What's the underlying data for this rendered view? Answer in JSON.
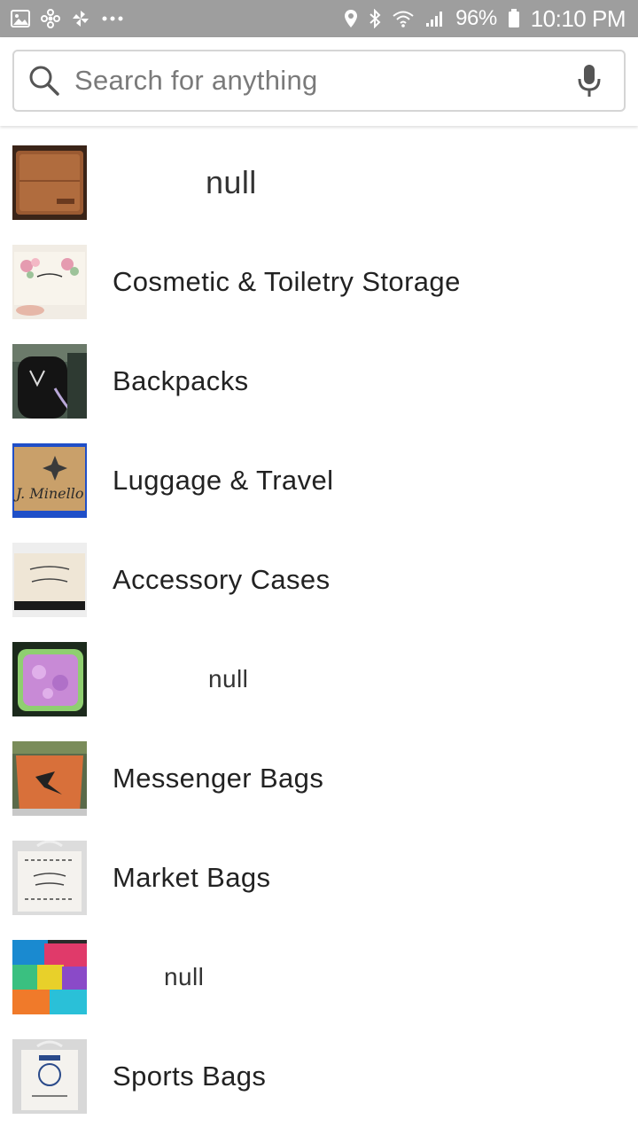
{
  "status_bar": {
    "battery": "96%",
    "time": "10:10 PM",
    "bg_color": "#9e9e9e",
    "left_icons": [
      "gallery-icon",
      "pinwheel-icon",
      "pinwheel-alt-icon",
      "more-dots-icon"
    ],
    "right_icons": [
      "location-icon",
      "bluetooth-icon",
      "wifi-icon",
      "signal-icon",
      "battery-icon"
    ]
  },
  "search": {
    "placeholder": "Search for anything",
    "value": "",
    "icon": "search-icon",
    "voice_icon": "mic-icon"
  },
  "categories": [
    {
      "label": "null",
      "thumbnail": "wallet-thumbnail"
    },
    {
      "label": "Cosmetic & Toiletry Storage",
      "thumbnail": "floral-pouch-thumbnail"
    },
    {
      "label": "Backpacks",
      "thumbnail": "backpack-thumbnail"
    },
    {
      "label": "Luggage & Travel",
      "thumbnail": "luggage-tag-thumbnail"
    },
    {
      "label": "Accessory Cases",
      "thumbnail": "sparkle-case-thumbnail"
    },
    {
      "label": "null",
      "thumbnail": "lunchbox-thumbnail"
    },
    {
      "label": "Messenger Bags",
      "thumbnail": "messenger-bag-thumbnail"
    },
    {
      "label": "Market Bags",
      "thumbnail": "tote-bag-thumbnail"
    },
    {
      "label": "null",
      "thumbnail": "colorful-bags-thumbnail"
    },
    {
      "label": "Sports Bags",
      "thumbnail": "sports-tote-thumbnail"
    }
  ]
}
